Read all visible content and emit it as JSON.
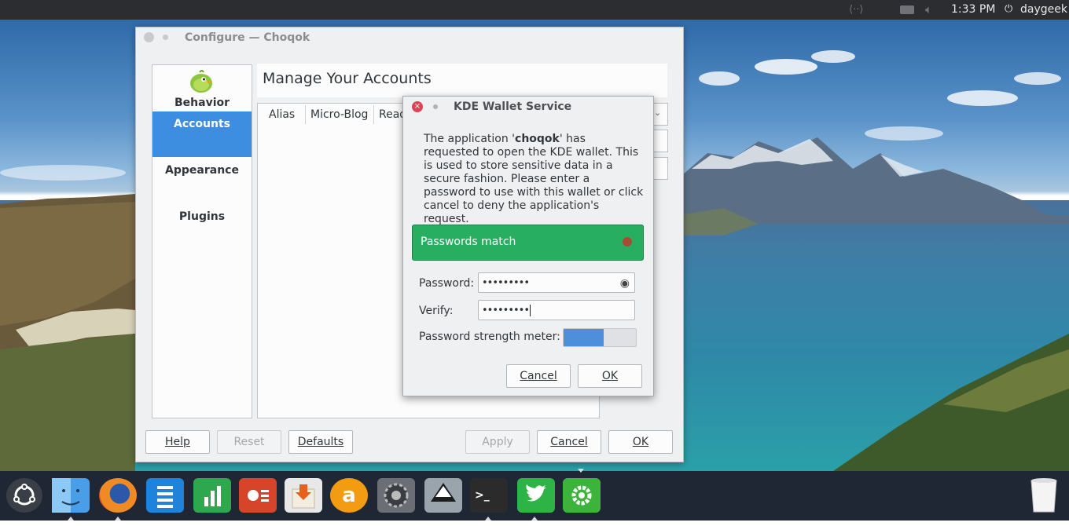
{
  "top_panel": {
    "time": "1:33 PM",
    "user": "daygeek",
    "icons": [
      "network-arrows-icon",
      "battery-icon",
      "volume-icon",
      "power-icon"
    ]
  },
  "configure_window": {
    "title": "Configure — Choqok",
    "sidebar": [
      "Behavior",
      "Accounts",
      "Appearance",
      "Plugins"
    ],
    "selected": "Accounts",
    "heading": "Manage Your Accounts",
    "columns": [
      "Alias",
      "Micro-Blog",
      "Read"
    ],
    "buttons": {
      "help": "Help",
      "reset": "Reset",
      "defaults": "Defaults",
      "apply": "Apply",
      "cancel": "Cancel",
      "ok": "OK"
    }
  },
  "wallet_dialog": {
    "title": "KDE Wallet Service",
    "message_pre": "The application '",
    "app_name": "choqok",
    "message_post": "' has requested to open the KDE wallet. This is used to store sensitive data in a secure fashion. Please enter a password to use with this wallet or click cancel to deny the application's request.",
    "banner": "Passwords match",
    "password_label": "Password:",
    "password_value": "•••••••••",
    "verify_label": "Verify:",
    "verify_value": "•••••••••",
    "strength_label": "Password strength meter:",
    "strength": 0.55,
    "cancel": "Cancel",
    "ok": "OK"
  },
  "dock": {
    "items": [
      "ubuntu-menu-icon",
      "finder-icon",
      "firefox-icon",
      "writer-icon",
      "calc-icon",
      "impress-icon",
      "software-install-icon",
      "amazon-icon",
      "system-settings-icon",
      "inkscape-icon",
      "terminal-icon",
      "twitter-icon",
      "choqok-settings-icon",
      "trash-icon"
    ],
    "colors": {
      "ubuntu": "#3a3f47",
      "finder": "#4a9ee8",
      "firefox": "#e66000",
      "writer": "#1f83db",
      "calc": "#2ea84f",
      "impress": "#d6442a",
      "software": "#e8e8e8",
      "amazon": "#f39c12",
      "settings": "#6b6f75",
      "inkscape": "#9aa4ad",
      "terminal": "#2b2b2b",
      "twitter": "#2eb446",
      "choqok": "#3cb43c"
    }
  }
}
